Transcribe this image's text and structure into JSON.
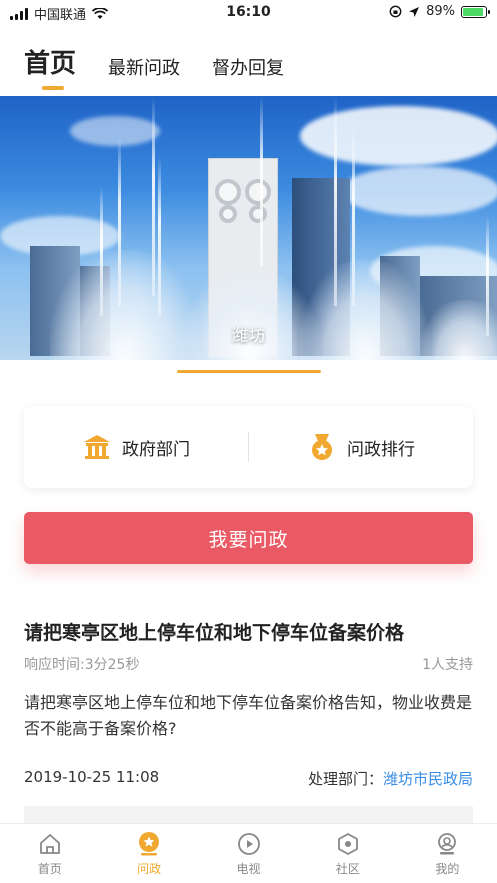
{
  "status_bar": {
    "carrier": "中国联通",
    "time": "16:10",
    "battery": "89%",
    "battery_level": 0.89
  },
  "top_tabs": [
    {
      "label": "首页",
      "active": true
    },
    {
      "label": "最新问政",
      "active": false
    },
    {
      "label": "督办回复",
      "active": false
    }
  ],
  "banner": {
    "caption": "潍坊"
  },
  "quick_links": [
    {
      "label": "政府部门",
      "icon": "building-icon"
    },
    {
      "label": "问政排行",
      "icon": "medal-icon"
    }
  ],
  "main_action": {
    "label": "我要问政"
  },
  "question": {
    "title": "请把寒亭区地上停车位和地下停车位备案价格",
    "response_time": "响应时间:3分25秒",
    "supporters": "1人支持",
    "body": "请把寒亭区地上停车位和地下停车位备案价格告知，物业收费是否不能高于备案价格?",
    "date": "2019-10-25 11:08",
    "dept_label": "处理部门：",
    "dept": "潍坊市民政局"
  },
  "bottom_nav": [
    {
      "label": "首页",
      "icon": "home-icon",
      "active": false
    },
    {
      "label": "问政",
      "icon": "question-star-icon",
      "active": true
    },
    {
      "label": "电视",
      "icon": "play-icon",
      "active": false
    },
    {
      "label": "社区",
      "icon": "community-icon",
      "active": false
    },
    {
      "label": "我的",
      "icon": "profile-icon",
      "active": false
    }
  ],
  "colors": {
    "accent": "#f0a830",
    "primary_button": "#ea5a65",
    "link": "#3a8ee6"
  }
}
